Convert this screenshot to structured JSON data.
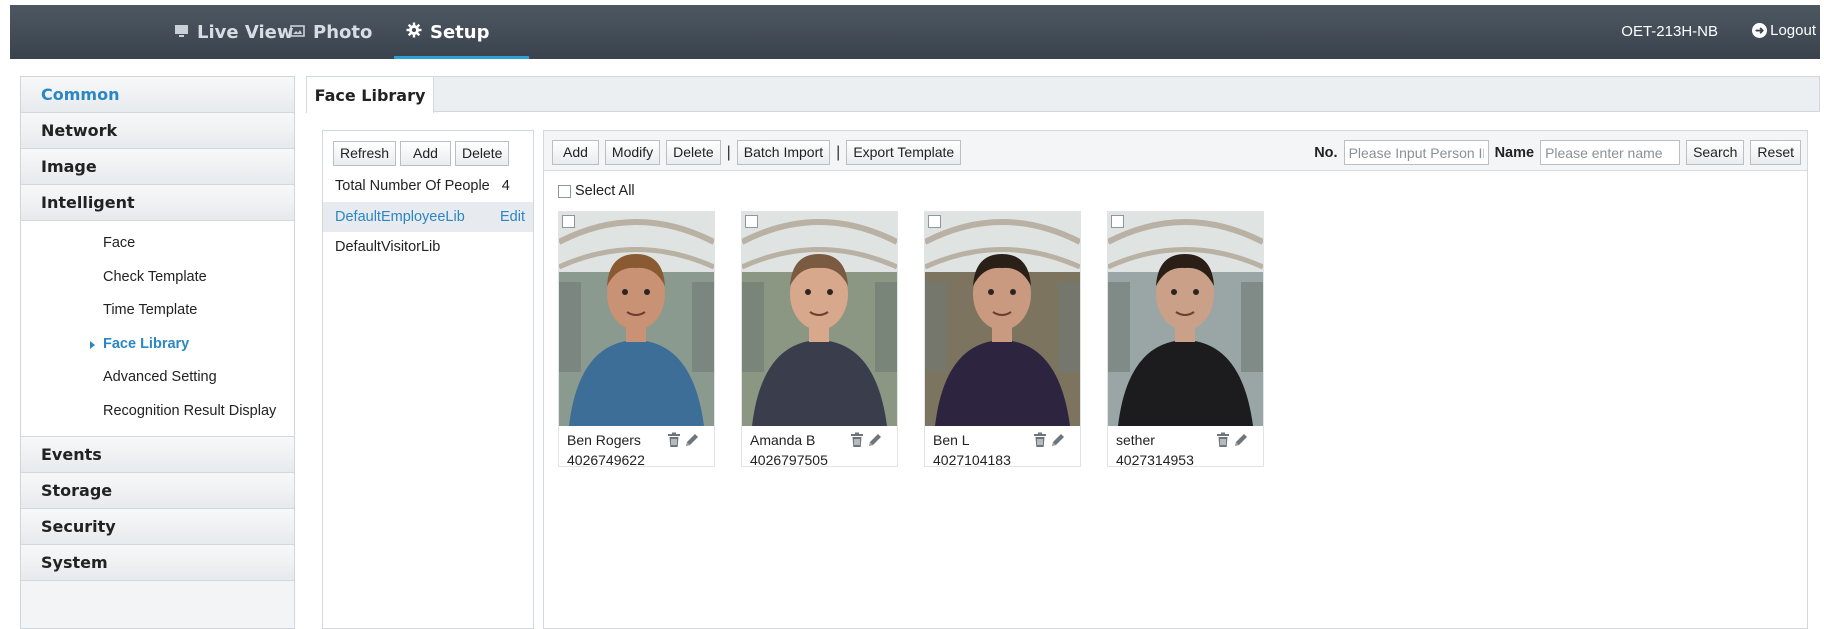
{
  "header": {
    "nav": [
      {
        "label": "Live View",
        "icon": "monitor-icon",
        "active": false
      },
      {
        "label": "Photo",
        "icon": "photo-icon",
        "active": false
      },
      {
        "label": "Setup",
        "icon": "gear-icon",
        "active": true
      }
    ],
    "device_name": "OET-213H-NB",
    "logout_label": "Logout"
  },
  "sidebar": {
    "categories": [
      {
        "label": "Common",
        "selected": true
      },
      {
        "label": "Network"
      },
      {
        "label": "Image"
      },
      {
        "label": "Intelligent",
        "expanded": true,
        "items": [
          "Face",
          "Check Template",
          "Time Template",
          "Face Library",
          "Advanced Setting",
          "Recognition Result Display"
        ],
        "selected_item": "Face Library"
      },
      {
        "label": "Events"
      },
      {
        "label": "Storage"
      },
      {
        "label": "Security"
      },
      {
        "label": "System"
      }
    ]
  },
  "content": {
    "tab_title": "Face Library",
    "library_panel": {
      "buttons": [
        "Refresh",
        "Add",
        "Delete"
      ],
      "total_label": "Total Number Of People",
      "total_count": "4",
      "libraries": [
        {
          "name": "DefaultEmployeeLib",
          "selected": true,
          "edit_label": "Edit"
        },
        {
          "name": "DefaultVisitorLib",
          "selected": false
        }
      ]
    },
    "toolbar": {
      "buttons": [
        "Add",
        "Modify",
        "Delete",
        "Batch Import",
        "Export Template"
      ],
      "no_label": "No.",
      "no_placeholder": "Please Input Person ID",
      "name_label": "Name",
      "name_placeholder": "Please enter name",
      "search_label": "Search",
      "reset_label": "Reset"
    },
    "select_all_label": "Select All",
    "people": [
      {
        "name": "Ben Rogers",
        "number": "4026749622",
        "shirt": "#3d6e97",
        "skin": "#c99274",
        "hair": "#8a5a33",
        "bg": "#8a9a8e"
      },
      {
        "name": "Amanda B",
        "number": "4026797505",
        "shirt": "#3a3e4c",
        "skin": "#d7a88c",
        "hair": "#7a5a40",
        "bg": "#8b9683"
      },
      {
        "name": "Ben L",
        "number": "4027104183",
        "shirt": "#2d2440",
        "skin": "#c99a80",
        "hair": "#2b2018",
        "bg": "#7d7460"
      },
      {
        "name": "sether",
        "number": "4027314953",
        "shirt": "#1c1c1e",
        "skin": "#caa088",
        "hair": "#2a1e16",
        "bg": "#9aa6a5"
      }
    ]
  }
}
